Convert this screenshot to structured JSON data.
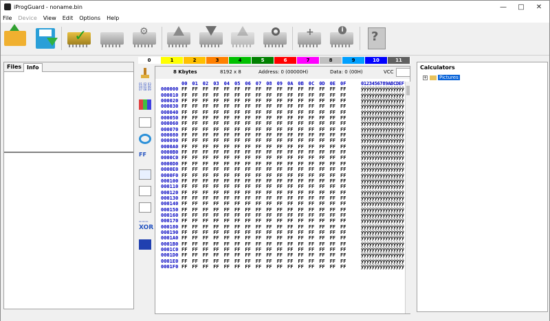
{
  "window": {
    "title": "iProgGuard - noname.bin"
  },
  "menu": [
    {
      "label": "File",
      "enabled": true
    },
    {
      "label": "Device",
      "enabled": false
    },
    {
      "label": "View",
      "enabled": true
    },
    {
      "label": "Edit",
      "enabled": true
    },
    {
      "label": "Options",
      "enabled": true
    },
    {
      "label": "Help",
      "enabled": true
    }
  ],
  "toolbar": {
    "icons": [
      "open-folder-icon",
      "save-icon",
      "verify-chip-icon",
      "chip-read-icon",
      "chip-settings-icon",
      "chip-upload-icon",
      "chip-download-icon",
      "chip-erase-icon",
      "chip-write-icon",
      "chip-compare-icon",
      "chip-info-icon",
      "help-document-icon"
    ]
  },
  "left_panel": {
    "tabs": [
      "Files",
      "Info"
    ],
    "active_tab": "Info"
  },
  "color_bar": [
    {
      "label": "0",
      "bg": "#ffffff"
    },
    {
      "label": "1",
      "bg": "#ffff00"
    },
    {
      "label": "2",
      "bg": "#ffc000"
    },
    {
      "label": "3",
      "bg": "#ff8000"
    },
    {
      "label": "4",
      "bg": "#00c000"
    },
    {
      "label": "5",
      "bg": "#008000"
    },
    {
      "label": "6",
      "bg": "#ff0000"
    },
    {
      "label": "7",
      "bg": "#ff00ff"
    },
    {
      "label": "8",
      "bg": "#c0c0c0"
    },
    {
      "label": "9",
      "bg": "#00a0ff"
    },
    {
      "label": "10",
      "bg": "#0000ff"
    },
    {
      "label": "11",
      "bg": "#606060"
    }
  ],
  "info_bar": {
    "size": "8 Kbytes",
    "org": "8192 x 8",
    "address": "Address: 0 (00000H)",
    "data": "Data: 0 (00H)",
    "vcc_label": "VCC"
  },
  "hex": {
    "columns": [
      "00",
      "01",
      "02",
      "03",
      "04",
      "05",
      "06",
      "07",
      "08",
      "09",
      "0A",
      "0B",
      "0C",
      "0D",
      "0E",
      "0F"
    ],
    "ascii_header": "0123456789ABCDEF",
    "fill_byte": "FF",
    "fill_ascii": "ÿÿÿÿÿÿÿÿÿÿÿÿÿÿÿÿ",
    "rows": [
      "000000",
      "000010",
      "000020",
      "000030",
      "000040",
      "000050",
      "000060",
      "000070",
      "000080",
      "000090",
      "0000A0",
      "0000B0",
      "0000C0",
      "0000D0",
      "0000E0",
      "0000F0",
      "000100",
      "000110",
      "000120",
      "000130",
      "000140",
      "000150",
      "000160",
      "000170",
      "000180",
      "000190",
      "0001A0",
      "0001B0",
      "0001C0",
      "0001D0",
      "0001E0",
      "0001F0"
    ]
  },
  "calculators": {
    "title": "Calculators",
    "items": [
      {
        "label": "Pictures",
        "selected": true
      }
    ]
  }
}
